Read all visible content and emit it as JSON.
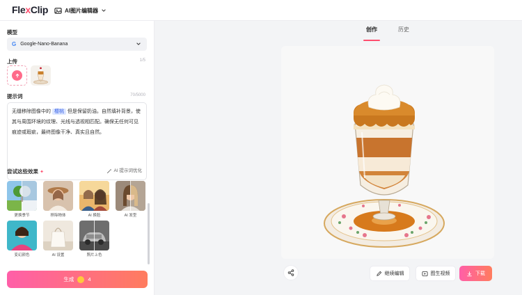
{
  "header": {
    "logo_main": "Fle",
    "logo_x": "x",
    "logo_end": "Clip",
    "tool_label": "AI图片编辑器"
  },
  "left": {
    "model_label": "模型",
    "model_value": "Google-Nano-Banana",
    "upload_label": "上传",
    "upload_count": "1/5",
    "prompt_label": "提示词",
    "prompt_count": "70/5000",
    "prompt_pre": "无缝移除图像中的",
    "prompt_highlight": "樱桃",
    "prompt_post": "但是保留奶油。自然填补背景，使其与周围环境的纹理、光线与透视相匹配。确保无任何可见痕迹或瑕疵，最终图像干净、真实且自然。",
    "ai_optimize": "AI 提示词优化",
    "try_label": "尝试这些效果",
    "effects": [
      {
        "label": "更换季节"
      },
      {
        "label": "移除物体"
      },
      {
        "label": "AI 换脸"
      },
      {
        "label": "AI 发型"
      },
      {
        "label": "变幻颜色"
      },
      {
        "label": "AI 设置"
      },
      {
        "label": "照片上色"
      }
    ],
    "generate_label": "生成",
    "generate_cost": "4"
  },
  "right": {
    "tabs": [
      {
        "label": "创作",
        "active": true
      },
      {
        "label": "历史",
        "active": false
      }
    ],
    "continue_edit": "继续编辑",
    "to_video": "图生视频",
    "download": "下载"
  },
  "colors": {
    "accent": "#ff4d6d",
    "gradient_start": "#ff5fa8",
    "gradient_end": "#ff7c5e"
  }
}
